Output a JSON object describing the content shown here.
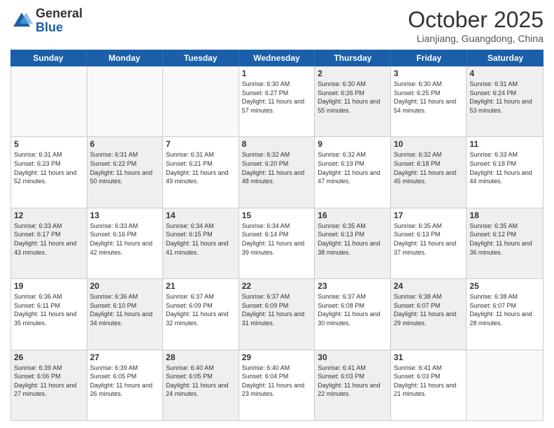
{
  "header": {
    "logo_general": "General",
    "logo_blue": "Blue",
    "month_title": "October 2025",
    "location": "Lianjiang, Guangdong, China"
  },
  "days_of_week": [
    "Sunday",
    "Monday",
    "Tuesday",
    "Wednesday",
    "Thursday",
    "Friday",
    "Saturday"
  ],
  "weeks": [
    [
      {
        "day": "",
        "sunrise": "",
        "sunset": "",
        "daylight": "",
        "shaded": false,
        "empty": true
      },
      {
        "day": "",
        "sunrise": "",
        "sunset": "",
        "daylight": "",
        "shaded": false,
        "empty": true
      },
      {
        "day": "",
        "sunrise": "",
        "sunset": "",
        "daylight": "",
        "shaded": false,
        "empty": true
      },
      {
        "day": "1",
        "sunrise": "Sunrise: 6:30 AM",
        "sunset": "Sunset: 6:27 PM",
        "daylight": "Daylight: 11 hours and 57 minutes.",
        "shaded": false,
        "empty": false
      },
      {
        "day": "2",
        "sunrise": "Sunrise: 6:30 AM",
        "sunset": "Sunset: 6:26 PM",
        "daylight": "Daylight: 11 hours and 55 minutes.",
        "shaded": true,
        "empty": false
      },
      {
        "day": "3",
        "sunrise": "Sunrise: 6:30 AM",
        "sunset": "Sunset: 6:25 PM",
        "daylight": "Daylight: 11 hours and 54 minutes.",
        "shaded": false,
        "empty": false
      },
      {
        "day": "4",
        "sunrise": "Sunrise: 6:31 AM",
        "sunset": "Sunset: 6:24 PM",
        "daylight": "Daylight: 11 hours and 53 minutes.",
        "shaded": true,
        "empty": false
      }
    ],
    [
      {
        "day": "5",
        "sunrise": "Sunrise: 6:31 AM",
        "sunset": "Sunset: 6:23 PM",
        "daylight": "Daylight: 11 hours and 52 minutes.",
        "shaded": false,
        "empty": false
      },
      {
        "day": "6",
        "sunrise": "Sunrise: 6:31 AM",
        "sunset": "Sunset: 6:22 PM",
        "daylight": "Daylight: 11 hours and 50 minutes.",
        "shaded": true,
        "empty": false
      },
      {
        "day": "7",
        "sunrise": "Sunrise: 6:31 AM",
        "sunset": "Sunset: 6:21 PM",
        "daylight": "Daylight: 11 hours and 49 minutes.",
        "shaded": false,
        "empty": false
      },
      {
        "day": "8",
        "sunrise": "Sunrise: 6:32 AM",
        "sunset": "Sunset: 6:20 PM",
        "daylight": "Daylight: 11 hours and 48 minutes.",
        "shaded": true,
        "empty": false
      },
      {
        "day": "9",
        "sunrise": "Sunrise: 6:32 AM",
        "sunset": "Sunset: 6:19 PM",
        "daylight": "Daylight: 11 hours and 47 minutes.",
        "shaded": false,
        "empty": false
      },
      {
        "day": "10",
        "sunrise": "Sunrise: 6:32 AM",
        "sunset": "Sunset: 6:18 PM",
        "daylight": "Daylight: 11 hours and 45 minutes.",
        "shaded": true,
        "empty": false
      },
      {
        "day": "11",
        "sunrise": "Sunrise: 6:33 AM",
        "sunset": "Sunset: 6:18 PM",
        "daylight": "Daylight: 11 hours and 44 minutes.",
        "shaded": false,
        "empty": false
      }
    ],
    [
      {
        "day": "12",
        "sunrise": "Sunrise: 6:33 AM",
        "sunset": "Sunset: 6:17 PM",
        "daylight": "Daylight: 11 hours and 43 minutes.",
        "shaded": true,
        "empty": false
      },
      {
        "day": "13",
        "sunrise": "Sunrise: 6:33 AM",
        "sunset": "Sunset: 6:16 PM",
        "daylight": "Daylight: 11 hours and 42 minutes.",
        "shaded": false,
        "empty": false
      },
      {
        "day": "14",
        "sunrise": "Sunrise: 6:34 AM",
        "sunset": "Sunset: 6:15 PM",
        "daylight": "Daylight: 11 hours and 41 minutes.",
        "shaded": true,
        "empty": false
      },
      {
        "day": "15",
        "sunrise": "Sunrise: 6:34 AM",
        "sunset": "Sunset: 6:14 PM",
        "daylight": "Daylight: 11 hours and 39 minutes.",
        "shaded": false,
        "empty": false
      },
      {
        "day": "16",
        "sunrise": "Sunrise: 6:35 AM",
        "sunset": "Sunset: 6:13 PM",
        "daylight": "Daylight: 11 hours and 38 minutes.",
        "shaded": true,
        "empty": false
      },
      {
        "day": "17",
        "sunrise": "Sunrise: 6:35 AM",
        "sunset": "Sunset: 6:13 PM",
        "daylight": "Daylight: 11 hours and 37 minutes.",
        "shaded": false,
        "empty": false
      },
      {
        "day": "18",
        "sunrise": "Sunrise: 6:35 AM",
        "sunset": "Sunset: 6:12 PM",
        "daylight": "Daylight: 11 hours and 36 minutes.",
        "shaded": true,
        "empty": false
      }
    ],
    [
      {
        "day": "19",
        "sunrise": "Sunrise: 6:36 AM",
        "sunset": "Sunset: 6:11 PM",
        "daylight": "Daylight: 11 hours and 35 minutes.",
        "shaded": false,
        "empty": false
      },
      {
        "day": "20",
        "sunrise": "Sunrise: 6:36 AM",
        "sunset": "Sunset: 6:10 PM",
        "daylight": "Daylight: 11 hours and 34 minutes.",
        "shaded": true,
        "empty": false
      },
      {
        "day": "21",
        "sunrise": "Sunrise: 6:37 AM",
        "sunset": "Sunset: 6:09 PM",
        "daylight": "Daylight: 11 hours and 32 minutes.",
        "shaded": false,
        "empty": false
      },
      {
        "day": "22",
        "sunrise": "Sunrise: 6:37 AM",
        "sunset": "Sunset: 6:09 PM",
        "daylight": "Daylight: 11 hours and 31 minutes.",
        "shaded": true,
        "empty": false
      },
      {
        "day": "23",
        "sunrise": "Sunrise: 6:37 AM",
        "sunset": "Sunset: 6:08 PM",
        "daylight": "Daylight: 11 hours and 30 minutes.",
        "shaded": false,
        "empty": false
      },
      {
        "day": "24",
        "sunrise": "Sunrise: 6:38 AM",
        "sunset": "Sunset: 6:07 PM",
        "daylight": "Daylight: 11 hours and 29 minutes.",
        "shaded": true,
        "empty": false
      },
      {
        "day": "25",
        "sunrise": "Sunrise: 6:38 AM",
        "sunset": "Sunset: 6:07 PM",
        "daylight": "Daylight: 11 hours and 28 minutes.",
        "shaded": false,
        "empty": false
      }
    ],
    [
      {
        "day": "26",
        "sunrise": "Sunrise: 6:39 AM",
        "sunset": "Sunset: 6:06 PM",
        "daylight": "Daylight: 11 hours and 27 minutes.",
        "shaded": true,
        "empty": false
      },
      {
        "day": "27",
        "sunrise": "Sunrise: 6:39 AM",
        "sunset": "Sunset: 6:05 PM",
        "daylight": "Daylight: 11 hours and 26 minutes.",
        "shaded": false,
        "empty": false
      },
      {
        "day": "28",
        "sunrise": "Sunrise: 6:40 AM",
        "sunset": "Sunset: 6:05 PM",
        "daylight": "Daylight: 11 hours and 24 minutes.",
        "shaded": true,
        "empty": false
      },
      {
        "day": "29",
        "sunrise": "Sunrise: 6:40 AM",
        "sunset": "Sunset: 6:04 PM",
        "daylight": "Daylight: 11 hours and 23 minutes.",
        "shaded": false,
        "empty": false
      },
      {
        "day": "30",
        "sunrise": "Sunrise: 6:41 AM",
        "sunset": "Sunset: 6:03 PM",
        "daylight": "Daylight: 11 hours and 22 minutes.",
        "shaded": true,
        "empty": false
      },
      {
        "day": "31",
        "sunrise": "Sunrise: 6:41 AM",
        "sunset": "Sunset: 6:03 PM",
        "daylight": "Daylight: 11 hours and 21 minutes.",
        "shaded": false,
        "empty": false
      },
      {
        "day": "",
        "sunrise": "",
        "sunset": "",
        "daylight": "",
        "shaded": true,
        "empty": true
      }
    ]
  ]
}
